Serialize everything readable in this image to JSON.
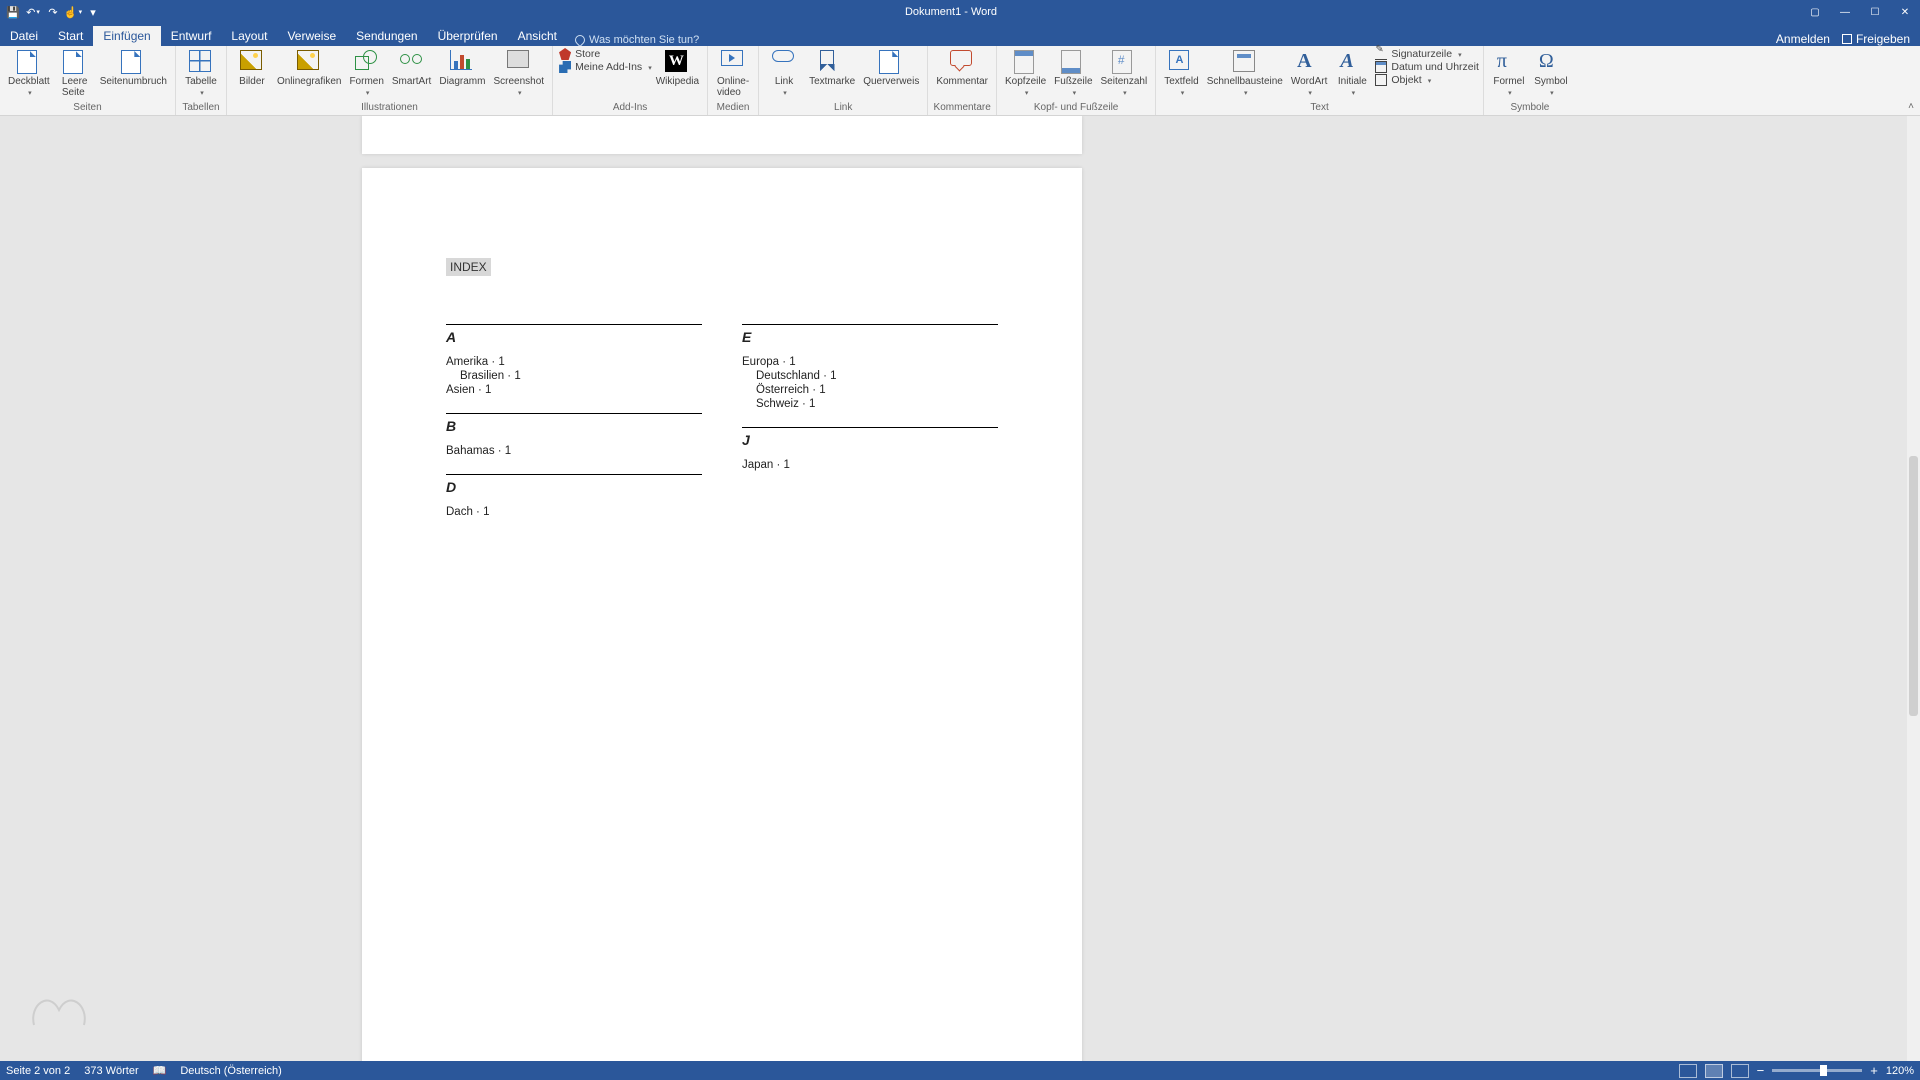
{
  "title": "Dokument1 - Word",
  "tabs": {
    "datei": "Datei",
    "start": "Start",
    "einfuegen": "Einfügen",
    "entwurf": "Entwurf",
    "layout": "Layout",
    "verweise": "Verweise",
    "sendungen": "Sendungen",
    "ueberpruefen": "Überprüfen",
    "ansicht": "Ansicht"
  },
  "tellme_placeholder": "Was möchten Sie tun?",
  "anmelden": "Anmelden",
  "freigeben": "Freigeben",
  "ribbon": {
    "seiten": {
      "label": "Seiten",
      "deckblatt": "Deckblatt",
      "leere_seite": "Leere\nSeite",
      "seitenumbruch": "Seitenumbruch"
    },
    "tabellen": {
      "label": "Tabellen",
      "tabelle": "Tabelle"
    },
    "illustrationen": {
      "label": "Illustrationen",
      "bilder": "Bilder",
      "onlinegrafiken": "Onlinegrafiken",
      "formen": "Formen",
      "smartart": "SmartArt",
      "diagramm": "Diagramm",
      "screenshot": "Screenshot"
    },
    "addins": {
      "label": "Add-Ins",
      "store": "Store",
      "meine": "Meine Add-Ins"
    },
    "wikipedia": "Wikipedia",
    "medien": {
      "label": "Medien",
      "video": "Online-\nvideo"
    },
    "link": {
      "label": "Link",
      "link": "Link",
      "textmarke": "Textmarke",
      "querverweis": "Querverweis"
    },
    "kommentare": {
      "label": "Kommentare",
      "kommentar": "Kommentar"
    },
    "kopf": {
      "label": "Kopf- und Fußzeile",
      "kopfzeile": "Kopfzeile",
      "fusszeile": "Fußzeile",
      "seitenzahl": "Seitenzahl"
    },
    "text": {
      "label": "Text",
      "textfeld": "Textfeld",
      "schnellbausteine": "Schnellbausteine",
      "wordart": "WordArt",
      "initiale": "Initiale",
      "signaturzeile": "Signaturzeile",
      "datum": "Datum und Uhrzeit",
      "objekt": "Objekt"
    },
    "symbole": {
      "label": "Symbole",
      "formel": "Formel",
      "symbol": "Symbol"
    }
  },
  "document": {
    "index_heading": "INDEX",
    "left": [
      {
        "letter": "A",
        "entries": [
          {
            "text": "Amerika · 1",
            "sub": false
          },
          {
            "text": "Brasilien · 1",
            "sub": true
          },
          {
            "text": "Asien · 1",
            "sub": false
          }
        ]
      },
      {
        "letter": "B",
        "entries": [
          {
            "text": "Bahamas · 1",
            "sub": false
          }
        ]
      },
      {
        "letter": "D",
        "entries": [
          {
            "text": "Dach · 1",
            "sub": false
          }
        ]
      }
    ],
    "right": [
      {
        "letter": "E",
        "entries": [
          {
            "text": "Europa · 1",
            "sub": false
          },
          {
            "text": "Deutschland · 1",
            "sub": true
          },
          {
            "text": "Österreich · 1",
            "sub": true
          },
          {
            "text": "Schweiz · 1",
            "sub": true
          }
        ]
      },
      {
        "letter": "J",
        "entries": [
          {
            "text": "Japan · 1",
            "sub": false
          }
        ]
      }
    ]
  },
  "status": {
    "page": "Seite 2 von 2",
    "words": "373 Wörter",
    "lang": "Deutsch (Österreich)",
    "zoom": "120%"
  }
}
